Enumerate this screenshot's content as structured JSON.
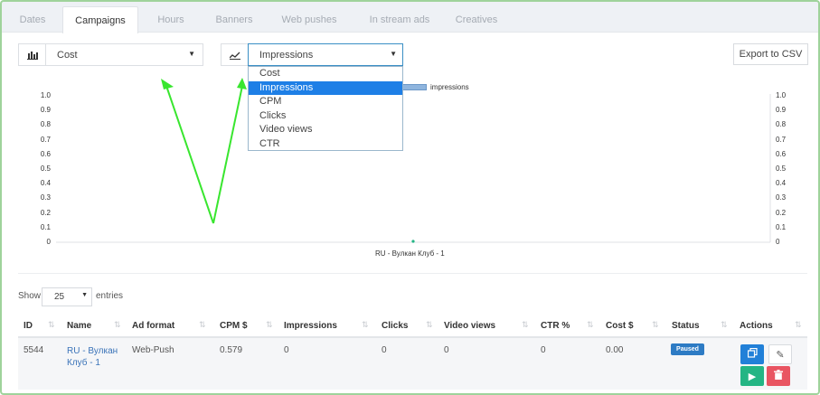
{
  "tabs": [
    "Dates",
    "Campaigns",
    "Hours",
    "Banners",
    "Web pushes",
    "In stream ads",
    "Creatives"
  ],
  "active_tab": "Campaigns",
  "left_select": {
    "value": "Cost",
    "icon": "bar-chart-icon"
  },
  "right_select": {
    "value": "Impressions",
    "icon": "line-chart-icon"
  },
  "export_label": "Export to CSV",
  "dropdown_options": [
    "Cost",
    "Impressions",
    "CPM",
    "Clicks",
    "Video views",
    "CTR"
  ],
  "dropdown_selected": "Impressions",
  "chart_data": {
    "type": "bar",
    "categories": [
      "RU - Вулкан Клуб - 1"
    ],
    "series": [
      {
        "name": "impressions",
        "values": [
          0
        ]
      }
    ],
    "ylim": [
      0,
      1.0
    ],
    "y_ticks": [
      "1.0",
      "0.9",
      "0.8",
      "0.7",
      "0.6",
      "0.5",
      "0.4",
      "0.3",
      "0.2",
      "0.1",
      "0"
    ],
    "secondary_y_ticks": [
      "1.0",
      "0.9",
      "0.8",
      "0.7",
      "0.6",
      "0.5",
      "0.4",
      "0.3",
      "0.2",
      "0.1",
      "0"
    ],
    "legend_position": "top-center",
    "grid": false
  },
  "table": {
    "show_label": "Show",
    "entries_value": "25",
    "entries_label": "entries",
    "columns": [
      "ID",
      "Name",
      "Ad format",
      "CPM $",
      "Impressions",
      "Clicks",
      "Video views",
      "CTR %",
      "Cost $",
      "Status",
      "Actions"
    ],
    "rows": [
      {
        "id": "5544",
        "name_line1": "RU - Вулкан",
        "name_line2": "Клуб - 1",
        "ad_format": "Web-Push",
        "cpm": "0.579",
        "impressions": "0",
        "clicks": "0",
        "video_views": "0",
        "ctr": "0",
        "cost": "0.00",
        "status": "Paused"
      }
    ]
  },
  "colors": {
    "accent": "#1e7fe6",
    "arrow": "#39e62f",
    "badge": "#2d7bc4",
    "copy_btn": "#2180d8",
    "play_btn": "#24b584",
    "delete_btn": "#e95562"
  }
}
